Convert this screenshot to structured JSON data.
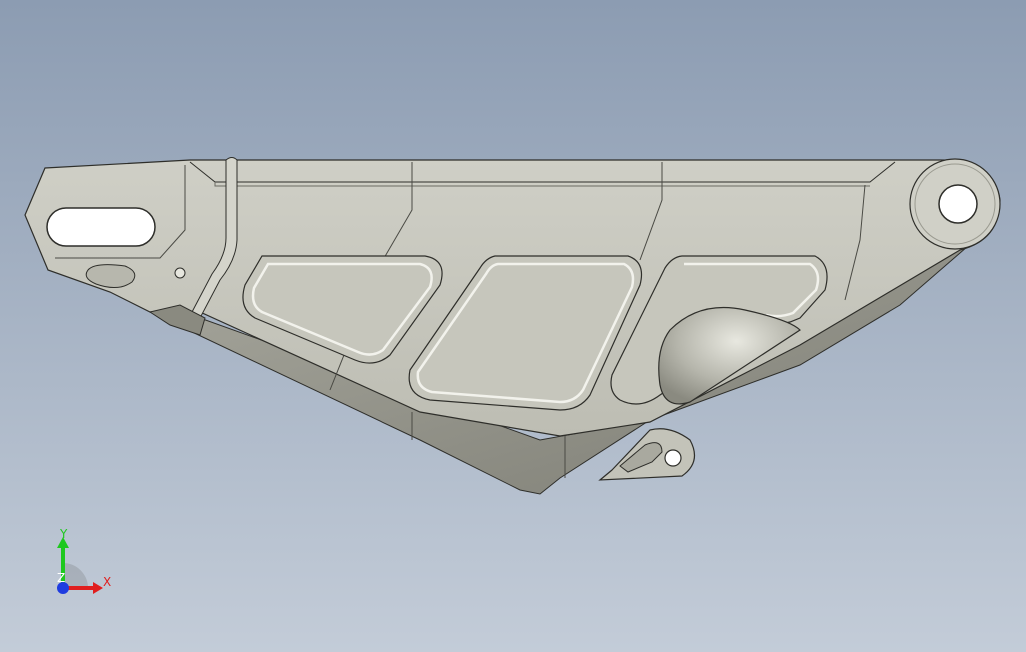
{
  "viewport": {
    "background_top": "#8c9cb2",
    "background_bottom": "#c3ccd8"
  },
  "model": {
    "body_color": "#c8c8be",
    "shadow_color": "#8e8e84",
    "edge_color": "#2e2e2a"
  },
  "triad": {
    "x_label": "X",
    "y_label": "Y",
    "z_label": "Z",
    "x_color": "#e01e1e",
    "y_color": "#1ec81e",
    "z_color": "#1e3ce0"
  }
}
